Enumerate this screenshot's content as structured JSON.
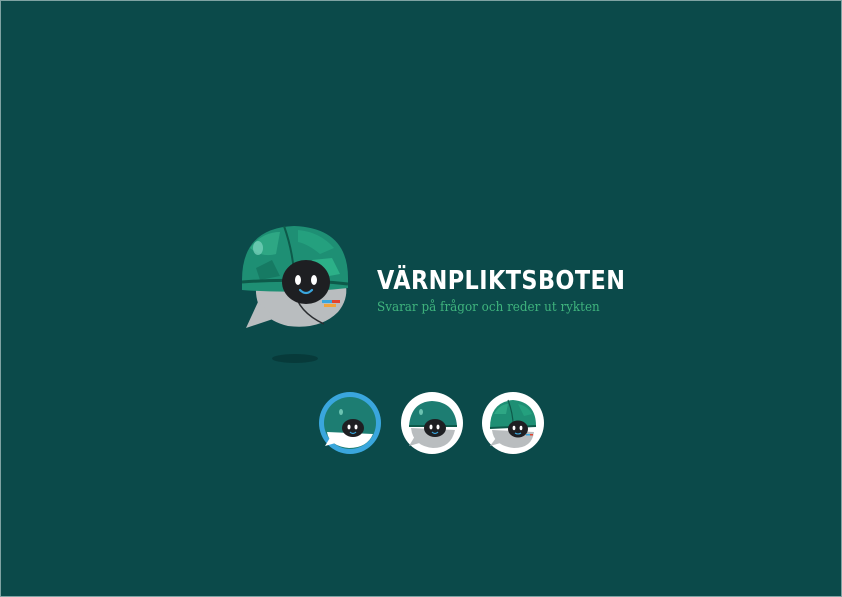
{
  "brand": {
    "name": "VÄRNPLIKTSBOTEN",
    "tagline": "Svarar på frågor och reder ut rykten"
  },
  "icons": {
    "mascot": "chatbot-helmet-mascot-icon",
    "variant_blue": "app-icon-blue-variant",
    "variant_white": "app-icon-white-variant",
    "variant_camo": "app-icon-camo-variant"
  },
  "colors": {
    "background": "#0b4a4a",
    "helmet": "#1e8f74",
    "tagline": "#3fb47d",
    "accent_blue": "#3aa6dd",
    "face": "#1e1f22"
  }
}
